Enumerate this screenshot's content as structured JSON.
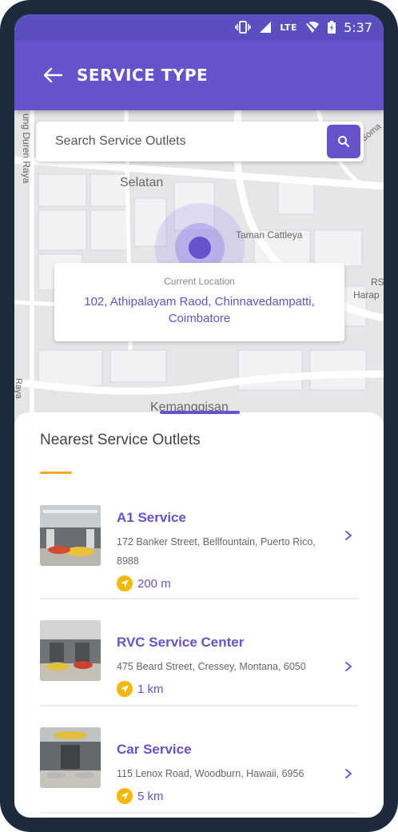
{
  "status_bar": {
    "network": "LTE",
    "time": "5:37"
  },
  "header": {
    "title": "SERVICE TYPE"
  },
  "search": {
    "placeholder": "Search Service Outlets"
  },
  "map": {
    "labels": [
      "Selatan",
      "Taman Cattleya",
      "Kemanggisan",
      "RS",
      "Harap",
      "ung Duren Raya",
      "Raya",
      "Soma",
      "berc"
    ]
  },
  "current_location": {
    "label": "Current Location",
    "address": "102, Athipalayam Raod, Chinnavedampatti, Coimbatore"
  },
  "outlets_section": {
    "title": "Nearest Service Outlets",
    "accent_color": "#f5a623",
    "items": [
      {
        "name": "A1 Service",
        "address": "172 Banker Street, Bellfountain, Puerto Rico, 8988",
        "distance": "200 m"
      },
      {
        "name": "RVC Service Center",
        "address": "475 Beard Street, Cressey, Montana, 6050",
        "distance": "1 km"
      },
      {
        "name": "Car Service",
        "address": "115 Lenox Road, Woodburn, Hawaii, 6956",
        "distance": "5 km"
      }
    ]
  },
  "colors": {
    "primary": "#6552cc",
    "distance_icon": "#f5b800"
  },
  "icons": {
    "back": "arrow-left-icon",
    "search": "search-icon",
    "chevron": "chevron-right-icon",
    "distance": "navigation-icon"
  }
}
